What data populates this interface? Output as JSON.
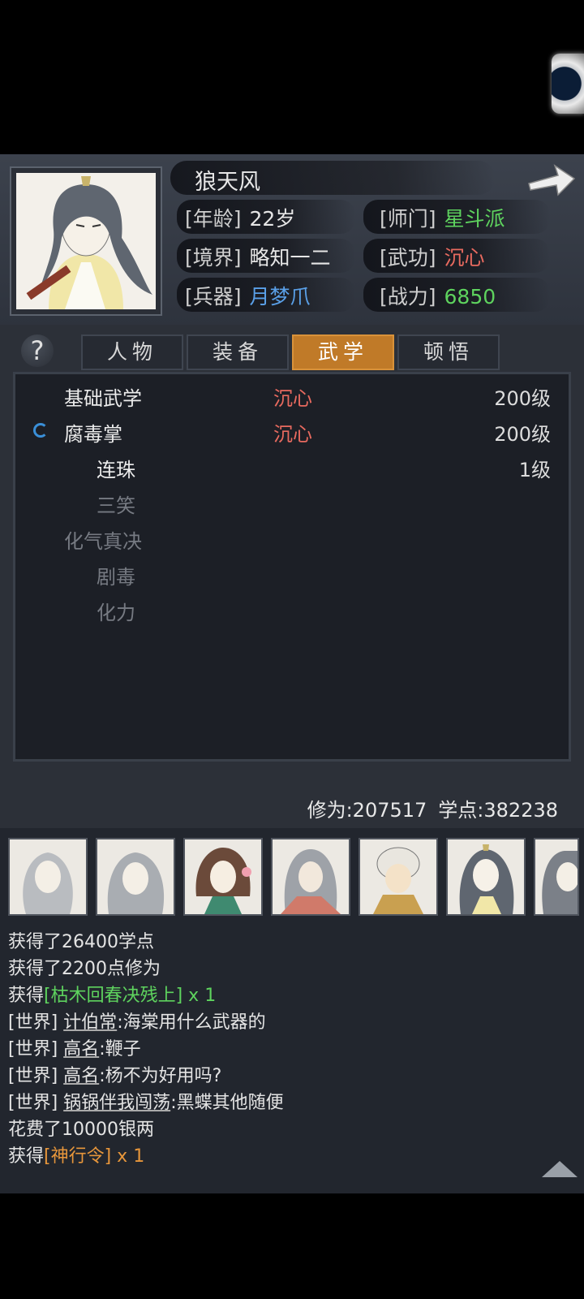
{
  "character": {
    "name": "狼天风",
    "age_label": "[年龄]",
    "age": "22岁",
    "sect_label": "[师门]",
    "sect": "星斗派",
    "realm_label": "[境界]",
    "realm": "略知一二",
    "martial_label": "[武功]",
    "martial": "沉心",
    "weapon_label": "[兵器]",
    "weapon": "月梦爪",
    "power_label": "[战力]",
    "power": "6850"
  },
  "tabs": [
    "人物",
    "装备",
    "武学",
    "顿悟"
  ],
  "active_tab": "武学",
  "skills": [
    {
      "name": "基础武学",
      "style": "沉心",
      "level": "200级",
      "dim": false
    },
    {
      "name": "腐毒掌",
      "style": "沉心",
      "level": "200级",
      "dim": false
    },
    {
      "name": "连珠",
      "style": "",
      "level": "1级",
      "dim": false
    },
    {
      "name": "三笑",
      "style": "",
      "level": "",
      "dim": true
    },
    {
      "name": "化气真决",
      "style": "",
      "level": "",
      "dim": true
    },
    {
      "name": "剧毒",
      "style": "",
      "level": "",
      "dim": true
    },
    {
      "name": "化力",
      "style": "",
      "level": "",
      "dim": true
    }
  ],
  "stats": {
    "cultivation": "修为:207517",
    "points": "学点:382238"
  },
  "log": {
    "l1": "获得了26400学点",
    "l2": "获得了2200点修为",
    "l3_pre": "获得",
    "l3_item": "[枯木回春决残上]",
    "l3_qty": " x 1",
    "l4_tag": "[世界]",
    "l4_user": "计伯常",
    "l4_msg": ":海棠用什么武器的",
    "l5_tag": "[世界]",
    "l5_user": "高名",
    "l5_msg": ":鞭子",
    "l6_tag": "[世界]",
    "l6_user": "高名",
    "l6_msg": ":杨不为好用吗?",
    "l7_tag": "[世界]",
    "l7_user": "锅锅伴我闯荡",
    "l7_msg": ":黑蝶其他随便",
    "l8": "花费了10000银两",
    "l9_pre": "获得",
    "l9_item": "[神行令]",
    "l9_qty": " x 1"
  },
  "colors": {
    "accent_tab": "#c07a28",
    "green": "#5ed35e",
    "red": "#e86a5f",
    "blue": "#5aa0e8",
    "orange": "#e7963b"
  },
  "icons": [
    "help-icon",
    "next-arrow-icon",
    "loading-icon",
    "scroll-up-icon"
  ]
}
